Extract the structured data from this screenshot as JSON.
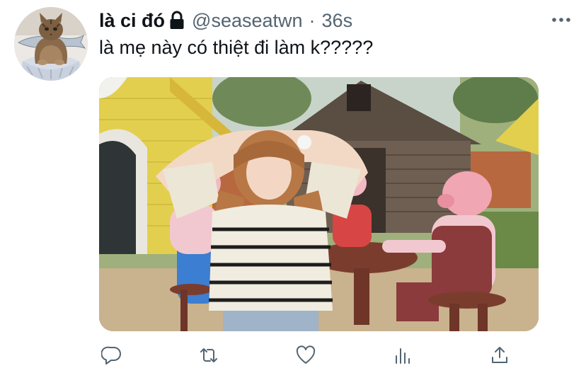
{
  "tweet": {
    "display_name": "là ci đó",
    "handle": "@seaseatwn",
    "separator": "·",
    "time": "36s",
    "text": "là mẹ này có thiệt đi làm k?????"
  },
  "icons": {
    "lock": "lock-icon",
    "more": "more-icon",
    "reply": "reply-icon",
    "retweet": "retweet-icon",
    "like": "like-icon",
    "analytics": "analytics-icon",
    "share": "share-icon"
  },
  "colors": {
    "text_primary": "#0f1419",
    "text_secondary": "#536471",
    "background": "#ffffff"
  }
}
